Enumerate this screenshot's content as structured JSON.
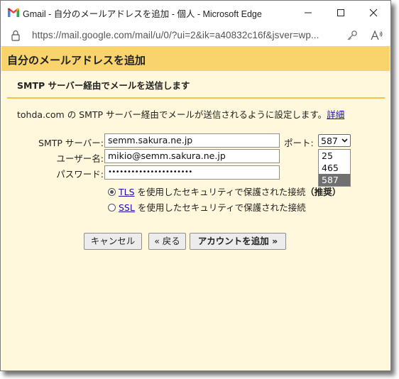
{
  "window": {
    "title": "Gmail - 自分のメールアドレスを追加 - 個人 - Microsoft Edge",
    "url": "https://mail.google.com/mail/u/0/?ui=2&ik=a40832c16f&jsver=wp..."
  },
  "dialog": {
    "title": "自分のメールアドレスを追加",
    "section_title": "SMTP サーバー経由でメールを送信します",
    "description": "tohda.com の SMTP サーバー経由でメールが送信されるように設定します。",
    "details_link": "詳細"
  },
  "form": {
    "smtp_label": "SMTP サーバー:",
    "smtp_value": "semm.sakura.ne.jp",
    "port_label": "ポート:",
    "port_value": "587",
    "port_options": [
      "25",
      "465",
      "587"
    ],
    "username_label": "ユーザー名:",
    "username_value": "mikio@semm.sakura.ne.jp",
    "password_label": "パスワード:",
    "password_value": "••••••••••••••••••••••",
    "tls_link": "TLS",
    "tls_text": " を使用したセキュリティで保護された接続",
    "tls_recommended": "（推奨）",
    "ssl_link": "SSL",
    "ssl_text": " を使用したセキュリティで保護された接続"
  },
  "buttons": {
    "cancel": "キャンセル",
    "back": "« 戻る",
    "add_account": "アカウントを追加 »"
  },
  "colors": {
    "header_bg": "#f9d46c",
    "panel_bg": "#fff8dc",
    "rule": "#f5c53c",
    "link": "#1a0dab"
  }
}
